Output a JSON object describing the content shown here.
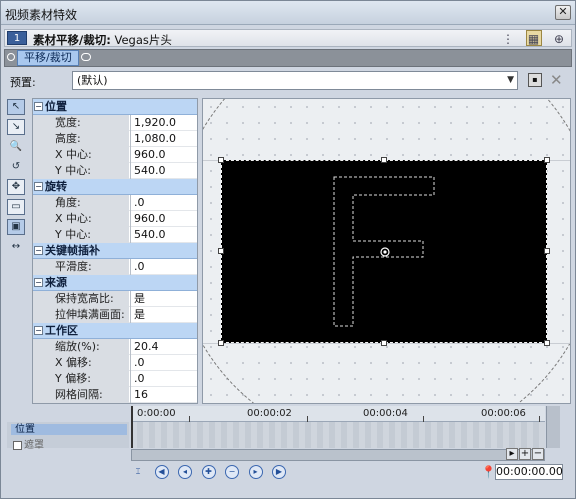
{
  "window": {
    "title": "视频素材特效",
    "close_label": "✕"
  },
  "chain": {
    "index": "1",
    "title_bold": "素材平移/裁切:",
    "title_rest": " Vegas片头"
  },
  "plugin": {
    "tab_label": "平移/裁切"
  },
  "preset": {
    "label": "预置:",
    "value": "(默认)"
  },
  "groups": [
    {
      "name": "位置",
      "rows": [
        {
          "k": "宽度:",
          "v": "1,920.0"
        },
        {
          "k": "高度:",
          "v": "1,080.0"
        },
        {
          "k": "X 中心:",
          "v": "960.0"
        },
        {
          "k": "Y 中心:",
          "v": "540.0"
        }
      ]
    },
    {
      "name": "旋转",
      "rows": [
        {
          "k": "角度:",
          "v": ".0"
        },
        {
          "k": "X 中心:",
          "v": "960.0"
        },
        {
          "k": "Y 中心:",
          "v": "540.0"
        }
      ]
    },
    {
      "name": "关键帧插补",
      "rows": [
        {
          "k": "平滑度:",
          "v": ".0"
        }
      ]
    },
    {
      "name": "来源",
      "rows": [
        {
          "k": "保持宽高比:",
          "v": "是"
        },
        {
          "k": "拉伸填满画面:",
          "v": "是"
        }
      ]
    },
    {
      "name": "工作区",
      "rows": [
        {
          "k": "缩放(%):",
          "v": "20.4"
        },
        {
          "k": "X 偏移:",
          "v": ".0"
        },
        {
          "k": "Y 偏移:",
          "v": ".0"
        },
        {
          "k": "网格间隔:",
          "v": "16"
        }
      ]
    }
  ],
  "canvas": {
    "frame_letter": "F"
  },
  "timeline": {
    "track_label": "位置",
    "mask_label": "遮罩",
    "ticks": [
      "0:00:00",
      "00:00:02",
      "00:00:04",
      "00:00:06"
    ],
    "current_time": "00:00:00.00"
  }
}
